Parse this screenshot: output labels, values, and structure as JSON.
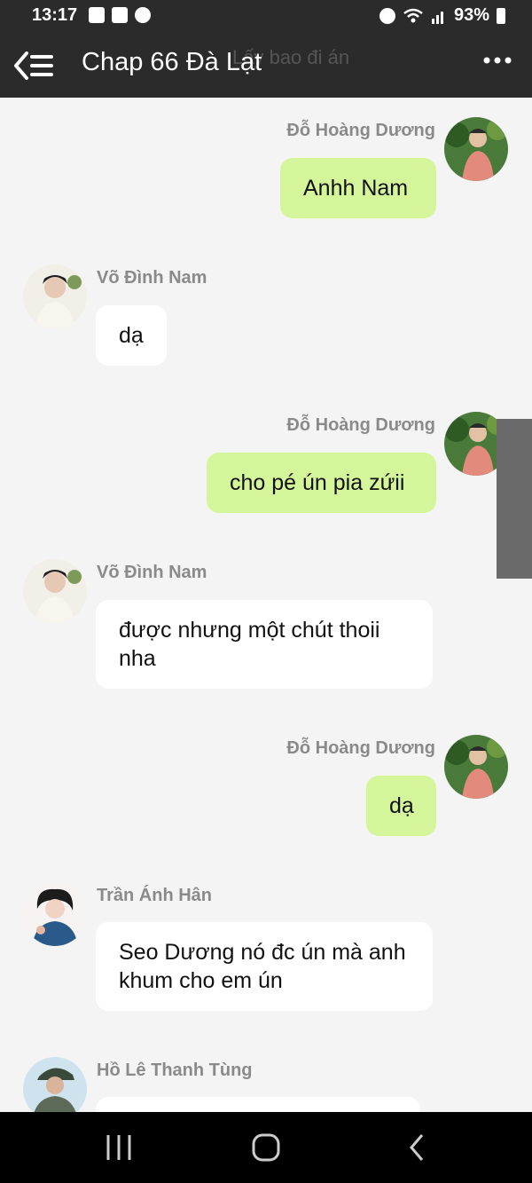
{
  "status_bar": {
    "time": "13:17",
    "battery": "93%",
    "icons": [
      "gallery-icon",
      "baomoi-icon",
      "messenger-icon",
      "alarm-icon",
      "wifi-icon",
      "signal-icon",
      "battery-icon"
    ]
  },
  "header": {
    "title": "Chap 66 Đà Lạt",
    "ghost_title": "Lấy bao đi án"
  },
  "messages": [
    {
      "sender": "Đỗ Hoàng Dương",
      "text": "Anhh Nam",
      "dir": "out"
    },
    {
      "sender": "Võ Đình Nam",
      "text": "dạ",
      "dir": "in"
    },
    {
      "sender": "Đỗ Hoàng Dương",
      "text": "cho pé ún pia zứii",
      "dir": "out"
    },
    {
      "sender": "Võ Đình Nam",
      "text": "được nhưng một chút thoii nha",
      "dir": "in"
    },
    {
      "sender": "Đỗ Hoàng Dương",
      "text": "dạ",
      "dir": "out"
    },
    {
      "sender": "Trần Ánh Hân",
      "text": "Seo Dương nó đc ún mà anh khum cho em ún",
      "dir": "in"
    },
    {
      "sender": "Hồ Lê Thanh Tùng",
      "text": "",
      "dir": "in"
    }
  ],
  "colors": {
    "header_bg": "#2b2b2b",
    "outgoing_bubble": "#d4f59a",
    "incoming_bubble": "#ffffff",
    "chat_bg": "#f4f4f4",
    "sender_name": "#8a8a8a"
  }
}
